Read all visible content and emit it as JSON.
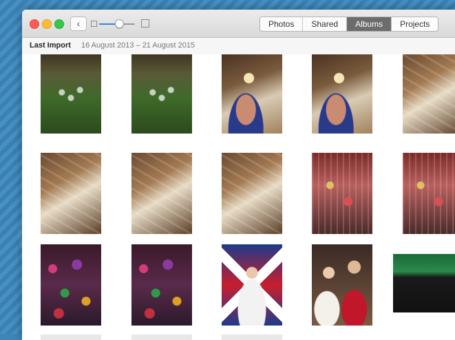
{
  "window": {
    "back_glyph": "‹"
  },
  "toolbar": {
    "tabs": [
      {
        "label": "Photos",
        "active": false
      },
      {
        "label": "Shared",
        "active": false
      },
      {
        "label": "Albums",
        "active": true
      },
      {
        "label": "Projects",
        "active": false
      }
    ],
    "zoom_level": 0.55
  },
  "moment": {
    "title": "Last Import",
    "date_range": "16 August 2013 – 21 August 2015"
  },
  "photos": [
    {
      "row": 0,
      "col": 0,
      "subject": "christmas tree"
    },
    {
      "row": 0,
      "col": 1,
      "subject": "christmas tree"
    },
    {
      "row": 0,
      "col": 2,
      "subject": "selfie"
    },
    {
      "row": 0,
      "col": 3,
      "subject": "selfie"
    },
    {
      "row": 0,
      "col": 4,
      "subject": "staircase"
    },
    {
      "row": 1,
      "col": 0,
      "subject": "staircase"
    },
    {
      "row": 1,
      "col": 1,
      "subject": "staircase"
    },
    {
      "row": 1,
      "col": 2,
      "subject": "staircase"
    },
    {
      "row": 1,
      "col": 3,
      "subject": "decorated hall"
    },
    {
      "row": 1,
      "col": 4,
      "subject": "decorated hall"
    },
    {
      "row": 2,
      "col": 0,
      "subject": "ornaments"
    },
    {
      "row": 2,
      "col": 1,
      "subject": "ornaments"
    },
    {
      "row": 2,
      "col": 2,
      "subject": "queen figure"
    },
    {
      "row": 2,
      "col": 3,
      "subject": "royal figures"
    },
    {
      "row": 2,
      "col": 4,
      "subject": "samsung sign"
    }
  ],
  "colors": {
    "active_tab": "#6c6c6c",
    "close": "#fc5b57",
    "minimize": "#fbbd2e",
    "maximize": "#35c94a"
  }
}
